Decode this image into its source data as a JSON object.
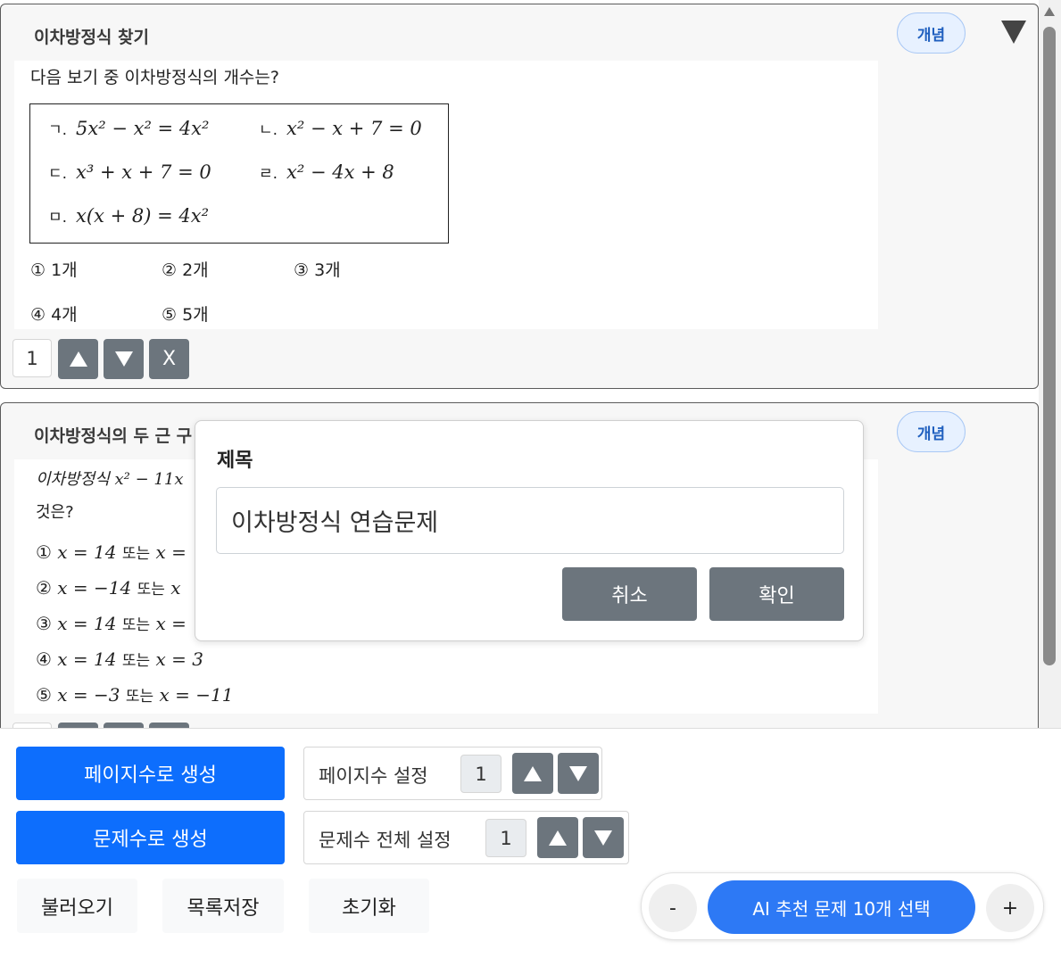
{
  "question1": {
    "title": "이차방정식 찾기",
    "concept_label": "개념",
    "prompt": "다음 보기 중 이차방정식의 개수는?",
    "box_items": [
      {
        "label": "ㄱ.",
        "expr": "5x² − x² = 4x²"
      },
      {
        "label": "ㄴ.",
        "expr": "x² − x + 7 = 0"
      },
      {
        "label": "ㄷ.",
        "expr": "x³ + x + 7 = 0"
      },
      {
        "label": "ㄹ.",
        "expr": "x² − 4x + 8"
      },
      {
        "label": "ㅁ.",
        "expr": "x(x + 8) = 4x²"
      }
    ],
    "options": [
      "① 1개",
      "② 2개",
      "③ 3개",
      "④ 4개",
      "⑤ 5개"
    ],
    "count": "1",
    "up_icon": "triangle-up-icon",
    "down_icon": "triangle-down-icon",
    "delete_label": "X"
  },
  "question2": {
    "title": "이차방정식의 두 근 구",
    "concept_label": "개념",
    "prompt_line1": "이차방정식 x² − 11x",
    "prompt_line2": "것은?",
    "options": [
      {
        "marker": "①",
        "expr_a": "x = 14",
        "sep": "또는",
        "expr_b": "x ="
      },
      {
        "marker": "②",
        "expr_a": "x = −14",
        "sep": "또는",
        "expr_b": "x"
      },
      {
        "marker": "③",
        "expr_a": "x = 14",
        "sep": "또는",
        "expr_b": "x ="
      },
      {
        "marker": "④",
        "expr_a": "x = 14",
        "sep": "또는",
        "expr_b": "x = 3"
      },
      {
        "marker": "⑤",
        "expr_a": "x = −3",
        "sep": "또는",
        "expr_b": "x = −11"
      }
    ]
  },
  "dialog": {
    "label": "제목",
    "input_value": "이차방정식 연습문제",
    "cancel_label": "취소",
    "confirm_label": "확인"
  },
  "bottom": {
    "generate_by_page": "페이지수로 생성",
    "generate_by_count": "문제수로 생성",
    "page_setting_label": "페이지수 설정",
    "page_setting_value": "1",
    "count_setting_label": "문제수 전체 설정",
    "count_setting_value": "1",
    "load_label": "불러오기",
    "save_list_label": "목록저장",
    "reset_label": "초기화",
    "ai_minus": "-",
    "ai_plus": "+",
    "ai_label": "AI 추천 문제 10개 선택"
  },
  "colors": {
    "primary": "#0d6efd",
    "secondary": "#6c757d",
    "ai_blue": "#2d79f5",
    "concept_bg": "#e7f1ff"
  }
}
